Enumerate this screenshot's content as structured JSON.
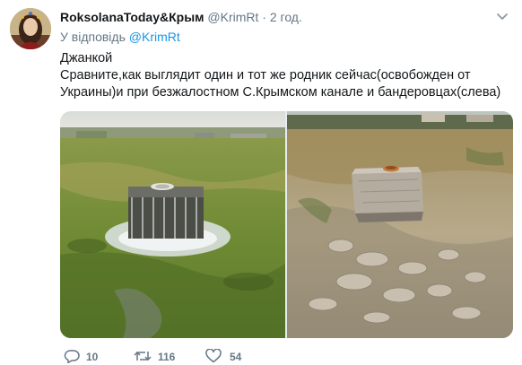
{
  "tweet": {
    "author_name": "RoksolanaToday&Крым",
    "author_handle": "@KrimRt",
    "separator": "·",
    "time": "2 год.",
    "reply_prefix": "У відповідь",
    "reply_to": "@KrimRt",
    "text_line1": "Джанкой",
    "text_line2": "Сравните,как выглядит один и тот же родник сейчас(освобожден от Украины)и при безжалостном С.Крымском канале и бандеровцах(слева)"
  },
  "actions": {
    "reply_count": "10",
    "retweet_count": "116",
    "like_count": "54"
  },
  "colors": {
    "text": "#14171a",
    "secondary": "#657786",
    "link": "#1b95e0"
  },
  "icons": [
    "avatar",
    "chevron-down-icon",
    "reply-icon",
    "retweet-icon",
    "like-icon"
  ]
}
